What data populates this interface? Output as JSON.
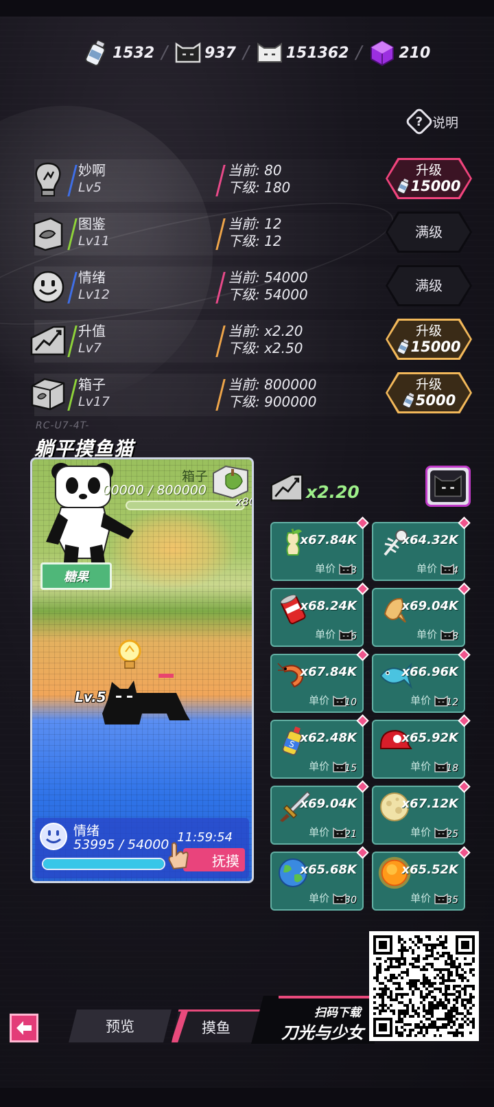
{
  "currency": [
    {
      "icon": "milk-bottle-icon",
      "value": "1532"
    },
    {
      "icon": "black-cat-icon",
      "value": "937"
    },
    {
      "icon": "white-cat-icon",
      "value": "151362"
    },
    {
      "icon": "purple-cube-icon",
      "value": "210"
    }
  ],
  "help_label": "说明",
  "upgrades": [
    {
      "name": "妙啊",
      "level": "Lv5",
      "current": "当前: 80",
      "next": "下级: 180",
      "button": {
        "type": "upgrade",
        "label": "升级",
        "cost": "15000",
        "style": "pink"
      }
    },
    {
      "name": "图鉴",
      "level": "Lv11",
      "current": "当前: 12",
      "next": "下级: 12",
      "button": {
        "type": "max",
        "label": "满级"
      }
    },
    {
      "name": "情绪",
      "level": "Lv12",
      "current": "当前: 54000",
      "next": "下级: 54000",
      "button": {
        "type": "max",
        "label": "满级"
      }
    },
    {
      "name": "升值",
      "level": "Lv7",
      "current": "当前: x2.20",
      "next": "下级: x2.50",
      "button": {
        "type": "upgrade",
        "label": "升级",
        "cost": "15000",
        "style": "gold"
      }
    },
    {
      "name": "箱子",
      "level": "Lv17",
      "current": "当前: 800000",
      "next": "下级: 900000",
      "button": {
        "type": "upgrade",
        "label": "升级",
        "cost": "5000",
        "style": "gold"
      }
    }
  ],
  "code": "RC-U7-4T-",
  "title": "躺平摸鱼猫",
  "game": {
    "candy_label": "糖果",
    "box_label": "箱子",
    "box_progress": "00000 / 800000",
    "box_multiplier": "x80",
    "cat_level": "Lv.5",
    "mood_label": "情绪",
    "mood_value": "53995 / 54000",
    "mood_fraction": 0.9999,
    "timer": "11:59:54",
    "pet_label": "抚摸"
  },
  "multiplier": "x2.20",
  "price_label": "单价",
  "items": [
    {
      "icon": "apple-core-icon",
      "count": "x67.84K",
      "price": "3"
    },
    {
      "icon": "fish-bone-icon",
      "count": "x64.32K",
      "price": "4"
    },
    {
      "icon": "soda-can-icon",
      "count": "x68.24K",
      "price": "6"
    },
    {
      "icon": "dried-fish-icon",
      "count": "x69.04K",
      "price": "8"
    },
    {
      "icon": "shrimp-icon",
      "count": "x67.84K",
      "price": "10"
    },
    {
      "icon": "blue-fish-icon",
      "count": "x66.96K",
      "price": "12"
    },
    {
      "icon": "spray-can-icon",
      "count": "x62.48K",
      "price": "15"
    },
    {
      "icon": "red-cap-icon",
      "count": "x65.92K",
      "price": "18"
    },
    {
      "icon": "sword-icon",
      "count": "x69.04K",
      "price": "21"
    },
    {
      "icon": "moon-icon",
      "count": "x67.12K",
      "price": "25"
    },
    {
      "icon": "earth-icon",
      "count": "x65.68K",
      "price": "30"
    },
    {
      "icon": "sun-icon",
      "count": "x65.52K",
      "price": "35"
    }
  ],
  "bottom": {
    "tab_preview": "预览",
    "tab_fish": "摸鱼",
    "promo_line1": "扫码下载",
    "promo_line2": "刀光与少女"
  }
}
